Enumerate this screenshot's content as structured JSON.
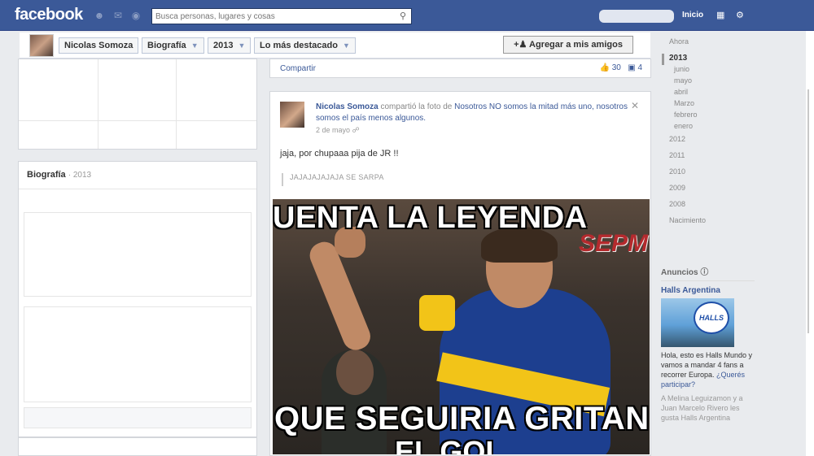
{
  "topbar": {
    "logo": "facebook",
    "search_placeholder": "Busca personas, lugares y cosas",
    "home_label": "Inicio"
  },
  "namebar": {
    "name": "Nicolas Somoza",
    "crumbs": [
      "Biografía",
      "2013",
      "Lo más destacado"
    ],
    "add_friend": "Agregar a mis amigos"
  },
  "left": {
    "bio_title": "Biografía",
    "bio_year": "· 2013"
  },
  "sharebar": {
    "share": "Compartir",
    "likes": "30",
    "comments": "4"
  },
  "post": {
    "author": "Nicolas Somoza",
    "action": "compartió la foto de",
    "page": "Nosotros NO somos la mitad más uno, nosotros somos el país menos algunos.",
    "date": "2 de mayo",
    "message": "jaja, por chupaaa pija de JR !!",
    "quote": "JAJAJAJAJAJA SE SARPA",
    "meme_top": "UENTA LA LEYENDA",
    "meme_bottom": "QUE SEGUIRIA GRITANDO",
    "meme_bottom2": "EL GOL",
    "watermark": "SEPM"
  },
  "timeline": {
    "items": [
      {
        "label": "Ahora",
        "level": "year"
      },
      {
        "label": "2013",
        "level": "current"
      },
      {
        "label": "junio",
        "level": "month"
      },
      {
        "label": "mayo",
        "level": "month"
      },
      {
        "label": "abril",
        "level": "month"
      },
      {
        "label": "Marzo",
        "level": "month"
      },
      {
        "label": "febrero",
        "level": "month"
      },
      {
        "label": "enero",
        "level": "month"
      },
      {
        "label": "2012",
        "level": "year"
      },
      {
        "label": "2011",
        "level": "year"
      },
      {
        "label": "2010",
        "level": "year"
      },
      {
        "label": "2009",
        "level": "year"
      },
      {
        "label": "2008",
        "level": "year"
      },
      {
        "label": "Nacimiento",
        "level": "year"
      }
    ]
  },
  "ads": {
    "title": "Anuncios",
    "advertiser": "Halls Argentina",
    "logo_text": "HALLS",
    "body": "Hola, esto es Halls Mundo y vamos a mandar 4 fans a recorrer Europa.",
    "cta": "¿Querés participar?",
    "social": "A Melina Leguizamon y a Juan Marcelo Rivero les gusta Halls Argentina"
  },
  "colors": {
    "brand": "#3b5998",
    "boca_blue": "#1d3f8f",
    "boca_yellow": "#f2c418"
  }
}
